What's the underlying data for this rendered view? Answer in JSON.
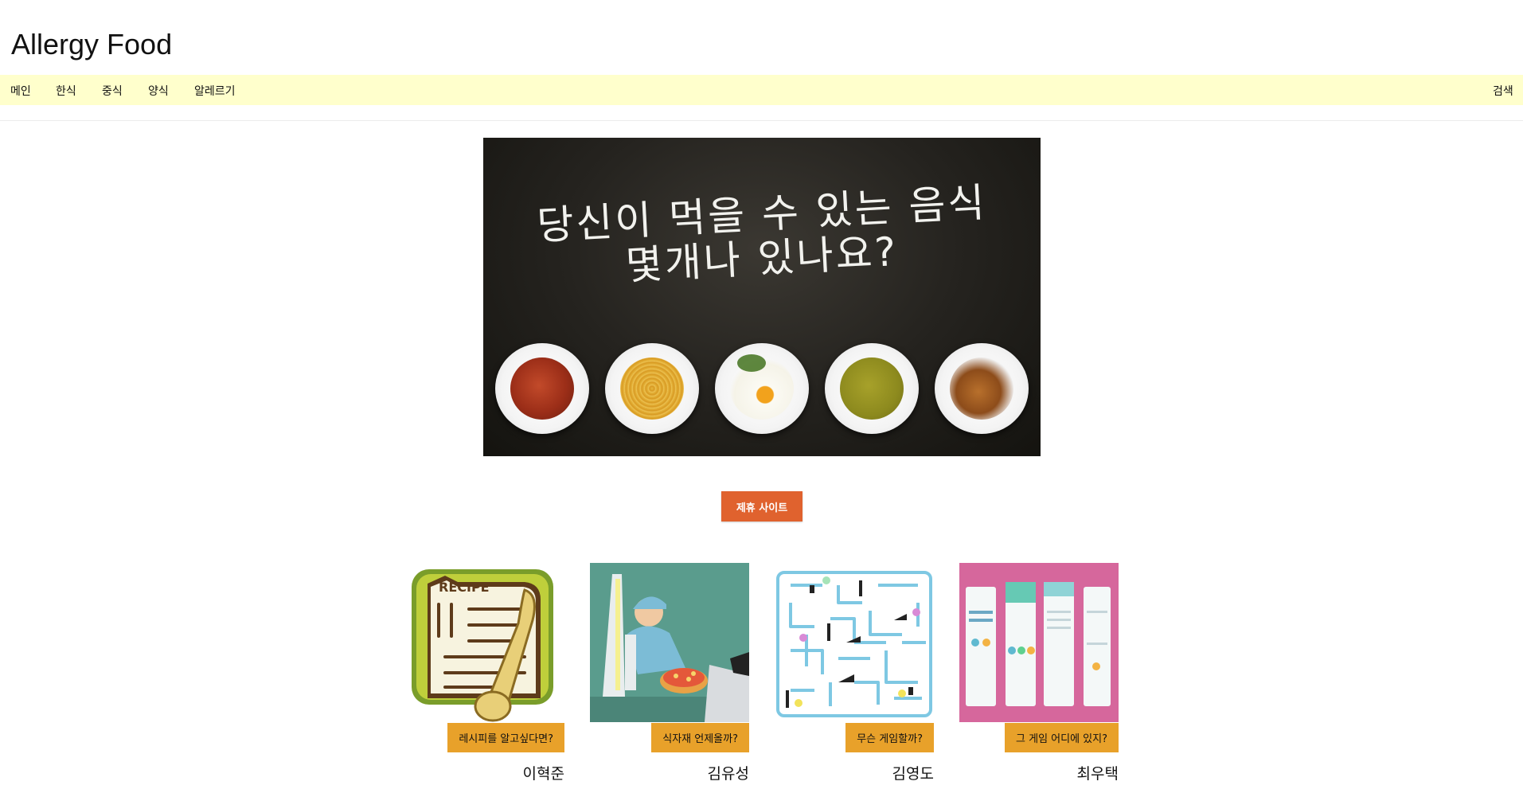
{
  "site": {
    "title": "Allergy Food"
  },
  "nav": {
    "items": [
      "메인",
      "한식",
      "중식",
      "양식",
      "알레르기"
    ],
    "search_label": "검색"
  },
  "hero": {
    "line1": "당신이 먹을 수 있는 음식",
    "line2": "몇개나 있나요?"
  },
  "partner_button": "제휴 사이트",
  "cards": [
    {
      "button": "레시피를 알고싶다면?",
      "name": "이혁준",
      "icon": "recipe-icon"
    },
    {
      "button": "식자재 언제올까?",
      "name": "김유성",
      "icon": "delivery-icon"
    },
    {
      "button": "무슨 게임할까?",
      "name": "김영도",
      "icon": "maze-game-icon"
    },
    {
      "button": "그 게임 어디에 있지?",
      "name": "최우택",
      "icon": "app-screens-icon"
    }
  ],
  "colors": {
    "nav_bg": "#ffffcc",
    "partner_button": "#e0622e",
    "card_button": "#e8a12a"
  }
}
